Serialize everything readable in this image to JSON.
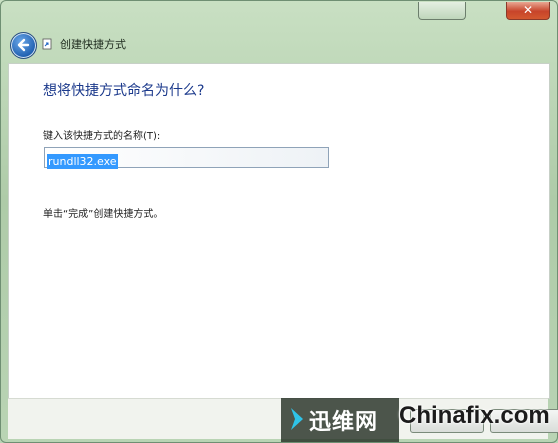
{
  "window": {
    "close_glyph": "✕"
  },
  "header": {
    "title": "创建快捷方式"
  },
  "main": {
    "heading": "想将快捷方式命名为什么?",
    "field_label": "键入该快捷方式的名称(T):",
    "field_value": "rundll32.exe",
    "note": "单击“完成”创建快捷方式。"
  },
  "watermark": {
    "cn_text": "迅维网",
    "en_text": "Chinafix.com"
  }
}
